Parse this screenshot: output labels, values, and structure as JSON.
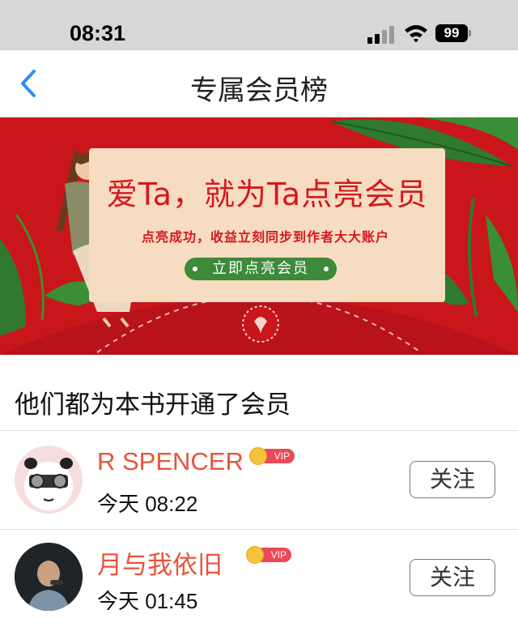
{
  "status_bar": {
    "time": "08:31",
    "battery": "99"
  },
  "nav": {
    "title": "专属会员榜",
    "back_icon": "chevron-left-icon"
  },
  "banner": {
    "headline": "爱Ta，就为Ta点亮会员",
    "subtitle": "点亮成功，收益立刻同步到作者大大账户",
    "cta_label": "立即点亮会员",
    "background_color": "#c9161a",
    "accent_green": "#3c8a3a"
  },
  "section": {
    "title": "他们都为本书开通了会员"
  },
  "members": [
    {
      "name": "R SPENCER",
      "badge": "VIP",
      "time": "今天 08:22",
      "follow_label": "关注"
    },
    {
      "name": "月与我依旧",
      "badge": "VIP",
      "time": "今天 01:45",
      "follow_label": "关注"
    }
  ],
  "colors": {
    "name_color": "#e8543a",
    "vip_color": "#e94a58",
    "link_blue": "#2f8ff0"
  }
}
